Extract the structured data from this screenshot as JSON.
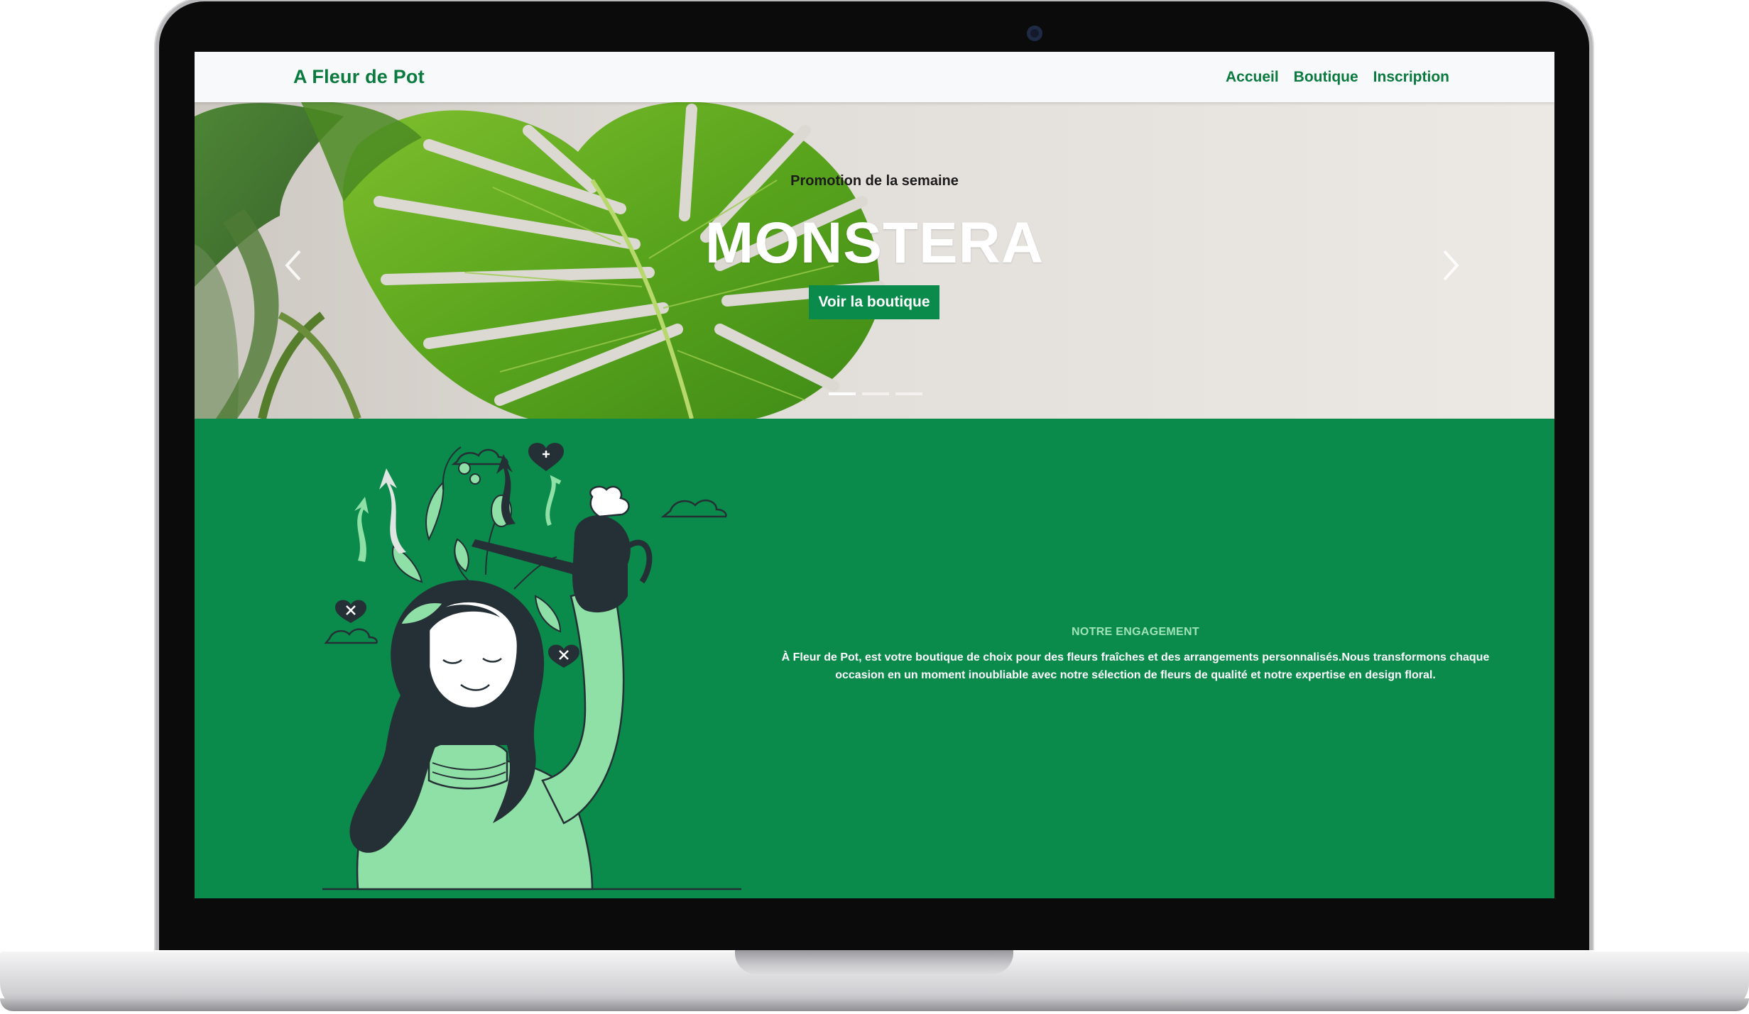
{
  "navbar": {
    "brand": "A Fleur de Pot",
    "links": [
      "Accueil",
      "Boutique",
      "Inscription"
    ]
  },
  "hero": {
    "subtitle": "Promotion de la semaine",
    "title": "MONSTERA",
    "button_label": "Voir la boutique",
    "slide_count": 3,
    "active_slide": 1
  },
  "engagement": {
    "title": "NOTRE ENGAGEMENT",
    "body": "À Fleur de Pot, est votre boutique de choix pour des fleurs fraîches et des arrangements personnalisés.Nous transformons chaque occasion en un moment inoubliable avec notre sélection de fleurs de qualité et notre expertise en design floral."
  },
  "icons": [
    "chevron-left-icon",
    "chevron-right-icon",
    "webcam-icon"
  ],
  "colors": {
    "brand_green": "#0a8a4b",
    "nav_text": "#0a7a3f",
    "navbar_bg": "#f8f9fa",
    "accent_light_green": "#9fe3b9",
    "illustration_sweater": "#8fe0a6",
    "illustration_dark": "#253036"
  }
}
